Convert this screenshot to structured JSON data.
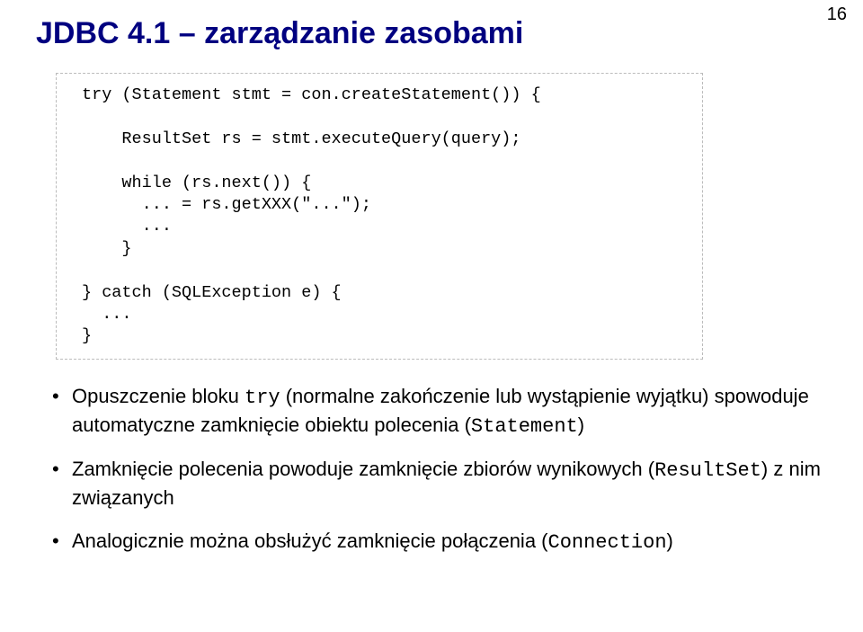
{
  "page_number": "16",
  "title": "JDBC 4.1 – zarządzanie zasobami",
  "code": {
    "l1": "try (Statement stmt = con.createStatement()) {",
    "l2": "",
    "l3": "    ResultSet rs = stmt.executeQuery(query);",
    "l4": "",
    "l5": "    while (rs.next()) {",
    "l6": "      ... = rs.getXXX(\"...\");",
    "l7": "      ...",
    "l8": "    }",
    "l9": "",
    "l10": "} catch (SQLException e) {",
    "l11": "  ...",
    "l12": "}"
  },
  "bullets": {
    "b1_a": "Opuszczenie bloku ",
    "b1_try": "try",
    "b1_b": " (normalne zakończenie lub wystąpienie wyjątku) spowoduje automatyczne zamknięcie obiektu polecenia (",
    "b1_stmt": "Statement",
    "b1_c": ")",
    "b2_a": "Zamknięcie polecenia powoduje zamknięcie zbiorów wynikowych (",
    "b2_rs": "ResultSet",
    "b2_b": ") z nim związanych",
    "b3_a": "Analogicznie można obsłużyć zamknięcie połączenia (",
    "b3_conn": "Connection",
    "b3_b": ")"
  }
}
